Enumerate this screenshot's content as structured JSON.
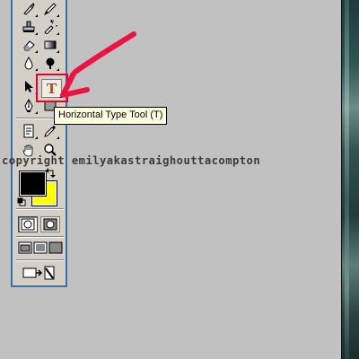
{
  "tooltip": {
    "text": "Horizontal Type Tool (T)"
  },
  "watermark": {
    "text": "copyright emilyakastraighouttacompton"
  },
  "active_tool": {
    "glyph": "T"
  },
  "colors": {
    "foreground": "#000000",
    "background": "#ffff00",
    "highlight": "#e3002a"
  },
  "tools": [
    "brush-tool-icon",
    "pencil-tool-icon",
    "clone-stamp-tool-icon",
    "history-brush-tool-icon",
    "eraser-tool-icon",
    "gradient-tool-icon",
    "blur-tool-icon",
    "burn-tool-icon",
    "path-selection-tool-icon",
    "horizontal-type-tool-icon",
    "pen-tool-icon",
    "rectangle-tool-icon",
    "notes-tool-icon",
    "eyedropper-tool-icon",
    "hand-tool-icon",
    "zoom-tool-icon"
  ]
}
